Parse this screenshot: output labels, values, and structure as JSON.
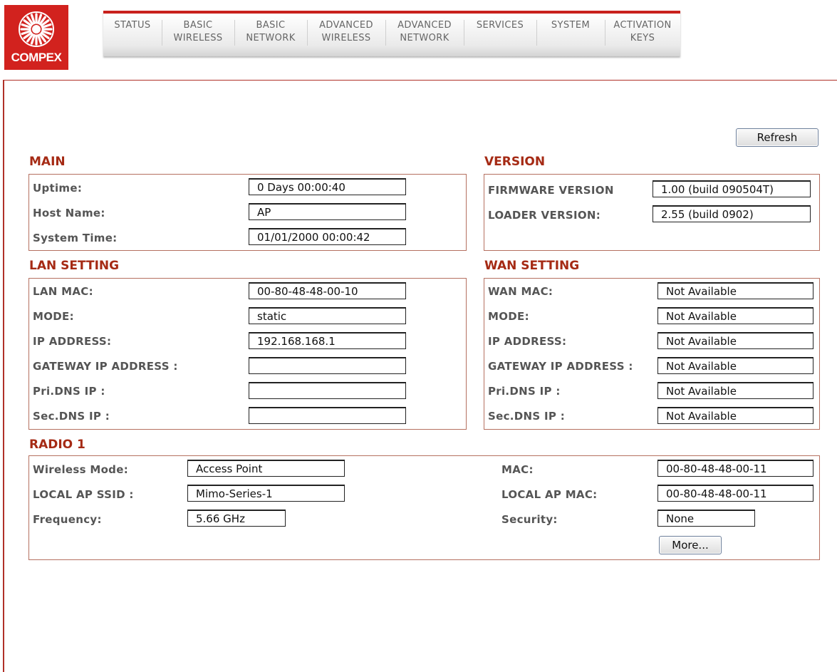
{
  "brand": {
    "logo_text": "COMPEX"
  },
  "nav": {
    "tabs": [
      {
        "label": "STATUS"
      },
      {
        "label": "BASIC\nWIRELESS"
      },
      {
        "label": "BASIC\nNETWORK"
      },
      {
        "label": "ADVANCED\nWIRELESS"
      },
      {
        "label": "ADVANCED\nNETWORK"
      },
      {
        "label": "SERVICES"
      },
      {
        "label": "SYSTEM"
      },
      {
        "label": "ACTIVATION\nKEYS"
      }
    ]
  },
  "actions": {
    "refresh": "Refresh",
    "more": "More..."
  },
  "main": {
    "title": "MAIN",
    "uptime_label": "Uptime:",
    "uptime": "0 Days 00:00:40",
    "hostname_label": "Host Name:",
    "hostname": "AP",
    "systime_label": "System Time:",
    "systime": "01/01/2000 00:00:42"
  },
  "version": {
    "title": "VERSION",
    "firmware_label": "FIRMWARE VERSION",
    "firmware": "1.00 (build 090504T)",
    "loader_label": "LOADER VERSION:",
    "loader": "2.55 (build 0902)"
  },
  "lan": {
    "title": "LAN SETTING",
    "mac_label": "LAN MAC:",
    "mac": "00-80-48-48-00-10",
    "mode_label": "MODE:",
    "mode": "static",
    "ip_label": "IP ADDRESS:",
    "ip": "192.168.168.1",
    "gw_label": "GATEWAY IP ADDRESS :",
    "gw": "",
    "pdns_label": "Pri.DNS IP :",
    "pdns": "",
    "sdns_label": "Sec.DNS IP :",
    "sdns": ""
  },
  "wan": {
    "title": "WAN SETTING",
    "mac_label": "WAN MAC:",
    "mac": "Not Available",
    "mode_label": "MODE:",
    "mode": "Not Available",
    "ip_label": "IP ADDRESS:",
    "ip": "Not Available",
    "gw_label": "GATEWAY IP ADDRESS :",
    "gw": "Not Available",
    "pdns_label": "Pri.DNS IP :",
    "pdns": "Not Available",
    "sdns_label": "Sec.DNS IP :",
    "sdns": "Not Available"
  },
  "radio": {
    "title": "RADIO 1",
    "mode_label": "Wireless Mode:",
    "mode": "Access Point",
    "ssid_label": "LOCAL AP SSID :",
    "ssid": "Mimo-Series-1",
    "freq_label": "Frequency:",
    "freq": "5.66 GHz",
    "mac_label": "MAC:",
    "mac": "00-80-48-48-00-11",
    "apmac_label": "LOCAL AP MAC:",
    "apmac": "00-80-48-48-00-11",
    "security_label": "Security:",
    "security": "None"
  }
}
